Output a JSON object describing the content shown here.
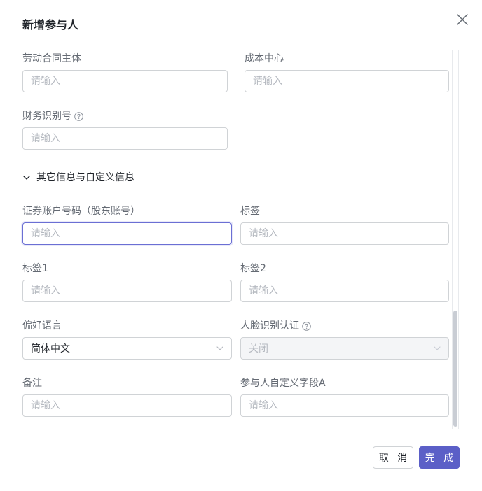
{
  "dialog": {
    "title": "新增参与人"
  },
  "fields": {
    "labor_contract": {
      "label": "劳动合同主体",
      "placeholder": "请输入",
      "value": ""
    },
    "cost_center": {
      "label": "成本中心",
      "placeholder": "请输入",
      "value": ""
    },
    "finance_id": {
      "label": "财务识别号",
      "placeholder": "请输入",
      "value": ""
    },
    "securities_account": {
      "label": "证券账户号码（股东账号）",
      "placeholder": "请输入",
      "value": ""
    },
    "tag": {
      "label": "标签",
      "placeholder": "请输入",
      "value": ""
    },
    "tag1": {
      "label": "标签1",
      "placeholder": "请输入",
      "value": ""
    },
    "tag2": {
      "label": "标签2",
      "placeholder": "请输入",
      "value": ""
    },
    "preferred_language": {
      "label": "偏好语言",
      "value": "简体中文"
    },
    "face_recognition": {
      "label": "人脸识别认证",
      "value": "关闭"
    },
    "remarks": {
      "label": "备注",
      "placeholder": "请输入",
      "value": ""
    },
    "custom_field_a": {
      "label": "参与人自定义字段A",
      "placeholder": "请输入",
      "value": ""
    }
  },
  "section": {
    "other_info": {
      "label": "其它信息与自定义信息",
      "expanded": true
    }
  },
  "footer": {
    "cancel_label": "取 消",
    "ok_label": "完 成"
  },
  "colors": {
    "primary": "#5b5fc7",
    "focus_border": "#6b6fd4",
    "border": "#d0d3d6",
    "placeholder": "#b5b9c0",
    "label": "#646a73",
    "disabled_bg": "#f4f5f7"
  },
  "icons": {
    "close": "close-icon",
    "help": "question-circle-icon",
    "expand": "chevron-down-icon",
    "select": "chevron-down-icon"
  }
}
